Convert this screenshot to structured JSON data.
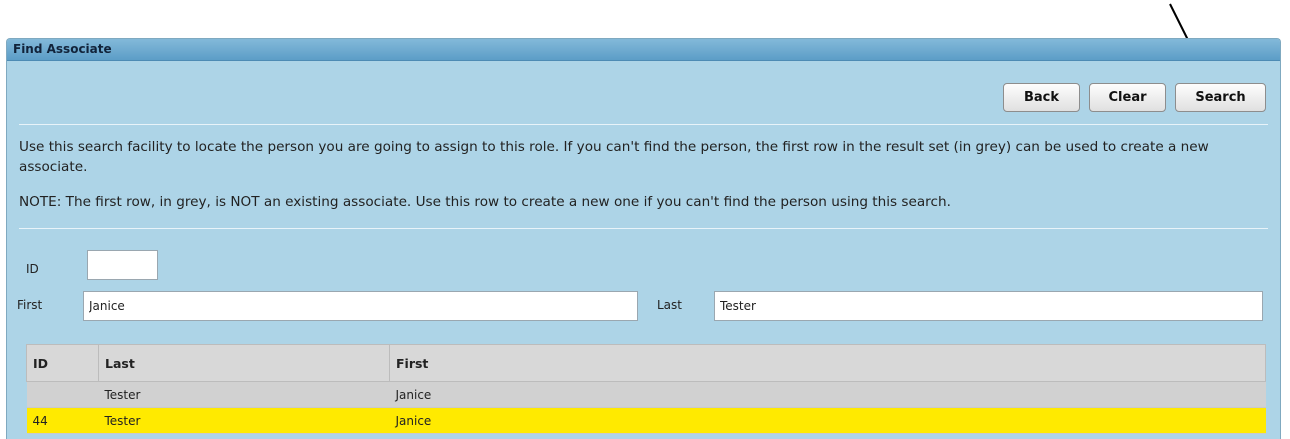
{
  "panel": {
    "title": "Find Associate"
  },
  "toolbar": {
    "back_label": "Back",
    "clear_label": "Clear",
    "search_label": "Search"
  },
  "help": {
    "paragraph_1": "Use this search facility to locate the person you are going to assign to this role. If you can't find the person, the first row in the result set (in grey) can be used to create a new associate.",
    "paragraph_2": "NOTE: The first row, in grey, is NOT an existing associate. Use this row to create a new one if you can't find the person using this search."
  },
  "form": {
    "id_label": "ID",
    "id_value": "",
    "first_label": "First",
    "first_value": "Janice",
    "last_label": "Last",
    "last_value": "Tester"
  },
  "results": {
    "columns": [
      "ID",
      "Last",
      "First"
    ],
    "rows": [
      {
        "id": "",
        "last": "Tester",
        "first": "Janice",
        "style": "new"
      },
      {
        "id": "44",
        "last": "Tester",
        "first": "Janice",
        "style": "match"
      }
    ]
  },
  "colors": {
    "panel_background": "#add4e7",
    "header_gradient_top": "#83b9d9",
    "header_gradient_bottom": "#5c9dc7",
    "new_row_grey": "#d1d1d1",
    "match_row_yellow": "#ffea00"
  },
  "annotation": {
    "icon": "pointer-arrow-icon"
  }
}
